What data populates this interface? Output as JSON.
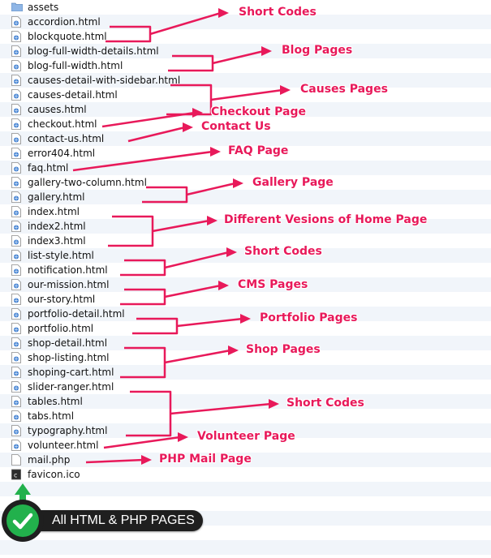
{
  "files": [
    {
      "name": "assets",
      "type": "folder"
    },
    {
      "name": "accordion.html",
      "type": "html"
    },
    {
      "name": "blockquote.html",
      "type": "html"
    },
    {
      "name": "blog-full-width-details.html",
      "type": "html"
    },
    {
      "name": "blog-full-width.html",
      "type": "html"
    },
    {
      "name": "causes-detail-with-sidebar.html",
      "type": "html"
    },
    {
      "name": "causes-detail.html",
      "type": "html"
    },
    {
      "name": "causes.html",
      "type": "html"
    },
    {
      "name": "checkout.html",
      "type": "html"
    },
    {
      "name": "contact-us.html",
      "type": "html"
    },
    {
      "name": "error404.html",
      "type": "html"
    },
    {
      "name": "faq.html",
      "type": "html"
    },
    {
      "name": "gallery-two-column.html",
      "type": "html"
    },
    {
      "name": "gallery.html",
      "type": "html"
    },
    {
      "name": "index.html",
      "type": "html"
    },
    {
      "name": "index2.html",
      "type": "html"
    },
    {
      "name": "index3.html",
      "type": "html"
    },
    {
      "name": "list-style.html",
      "type": "html"
    },
    {
      "name": "notification.html",
      "type": "html"
    },
    {
      "name": "our-mission.html",
      "type": "html"
    },
    {
      "name": "our-story.html",
      "type": "html"
    },
    {
      "name": "portfolio-detail.html",
      "type": "html"
    },
    {
      "name": "portfolio.html",
      "type": "html"
    },
    {
      "name": "shop-detail.html",
      "type": "html"
    },
    {
      "name": "shop-listing.html",
      "type": "html"
    },
    {
      "name": "shoping-cart.html",
      "type": "html"
    },
    {
      "name": "slider-ranger.html",
      "type": "html"
    },
    {
      "name": "tables.html",
      "type": "html"
    },
    {
      "name": "tabs.html",
      "type": "html"
    },
    {
      "name": "typography.html",
      "type": "html"
    },
    {
      "name": "volunteer.html",
      "type": "html"
    },
    {
      "name": "mail.php",
      "type": "php"
    },
    {
      "name": "favicon.ico",
      "type": "ico"
    }
  ],
  "annotations": [
    {
      "label": "Short Codes",
      "first": 1,
      "last": 2,
      "style": "bracket"
    },
    {
      "label": "Blog Pages",
      "first": 3,
      "last": 4,
      "style": "bracket"
    },
    {
      "label": "Causes Pages",
      "first": 5,
      "last": 7,
      "style": "bracket"
    },
    {
      "label": "Checkout Page",
      "first": 8,
      "last": 8,
      "style": "arrow"
    },
    {
      "label": "Contact Us",
      "first": 9,
      "last": 9,
      "style": "arrow"
    },
    {
      "label": "FAQ Page",
      "first": 11,
      "last": 11,
      "style": "arrow"
    },
    {
      "label": "Gallery Page",
      "first": 12,
      "last": 13,
      "style": "bracket"
    },
    {
      "label": "Different Vesions of Home Page",
      "first": 14,
      "last": 16,
      "style": "bracket"
    },
    {
      "label": "Short Codes",
      "first": 17,
      "last": 18,
      "style": "bracket"
    },
    {
      "label": "CMS Pages",
      "first": 19,
      "last": 20,
      "style": "bracket"
    },
    {
      "label": "Portfolio Pages",
      "first": 21,
      "last": 22,
      "style": "bracket"
    },
    {
      "label": "Shop Pages",
      "first": 23,
      "last": 25,
      "style": "bracket"
    },
    {
      "label": "Short Codes",
      "first": 26,
      "last": 29,
      "style": "bracket"
    },
    {
      "label": "Volunteer Page",
      "first": 30,
      "last": 30,
      "style": "arrow"
    },
    {
      "label": "PHP Mail Page",
      "first": 31,
      "last": 31,
      "style": "arrow"
    }
  ],
  "badge": {
    "text": "All HTML & PHP PAGES",
    "icon": "check-icon"
  },
  "colors": {
    "annotation": "#e8195a",
    "badge_bg": "#1f1f1f",
    "badge_check": "#22b14c",
    "row_alt": "#f1f5fa",
    "folder": "#8fb6e6"
  }
}
